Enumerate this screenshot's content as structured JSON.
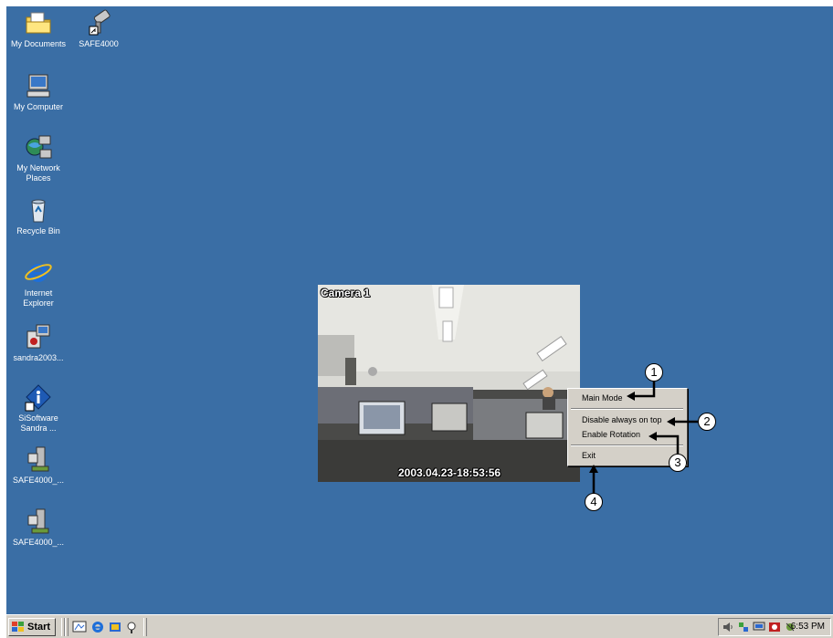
{
  "desktop": {
    "icons": [
      {
        "name": "My Documents",
        "icon": "folder-documents-icon"
      },
      {
        "name": "SAFE4000",
        "icon": "camera-shortcut-icon"
      },
      {
        "name": "My Computer",
        "icon": "computer-icon"
      },
      {
        "name": "My Network Places",
        "icon": "network-icon"
      },
      {
        "name": "Recycle Bin",
        "icon": "recycle-bin-icon"
      },
      {
        "name": "Internet Explorer",
        "icon": "internet-explorer-icon"
      },
      {
        "name": "sandra2003...",
        "icon": "installer-icon"
      },
      {
        "name": "SiSoftware Sandra ...",
        "icon": "sisoftware-icon"
      },
      {
        "name": "SAFE4000_...",
        "icon": "setup-icon"
      },
      {
        "name": "SAFE4000_...",
        "icon": "setup-icon"
      }
    ]
  },
  "camera": {
    "title": "Camera 1",
    "timestamp": "2003.04.23-18:53:56"
  },
  "context_menu": {
    "items": [
      {
        "label": "Main Mode"
      },
      {
        "label": "Disable always on top"
      },
      {
        "label": "Enable Rotation"
      },
      {
        "label": "Exit"
      }
    ]
  },
  "callouts": [
    "1",
    "2",
    "3",
    "4"
  ],
  "taskbar": {
    "start_label": "Start",
    "clock": "6:53 PM",
    "quick_launch": [
      "show-desktop-icon",
      "internet-explorer-icon",
      "outlook-icon",
      "search-icon"
    ],
    "tray_icons": [
      "volume-icon",
      "network-tray-icon",
      "display-tray-icon",
      "antivirus-icon",
      "agent-icon"
    ]
  },
  "colors": {
    "desktop": "#3a6ea5",
    "taskbar": "#d4d0c8"
  }
}
